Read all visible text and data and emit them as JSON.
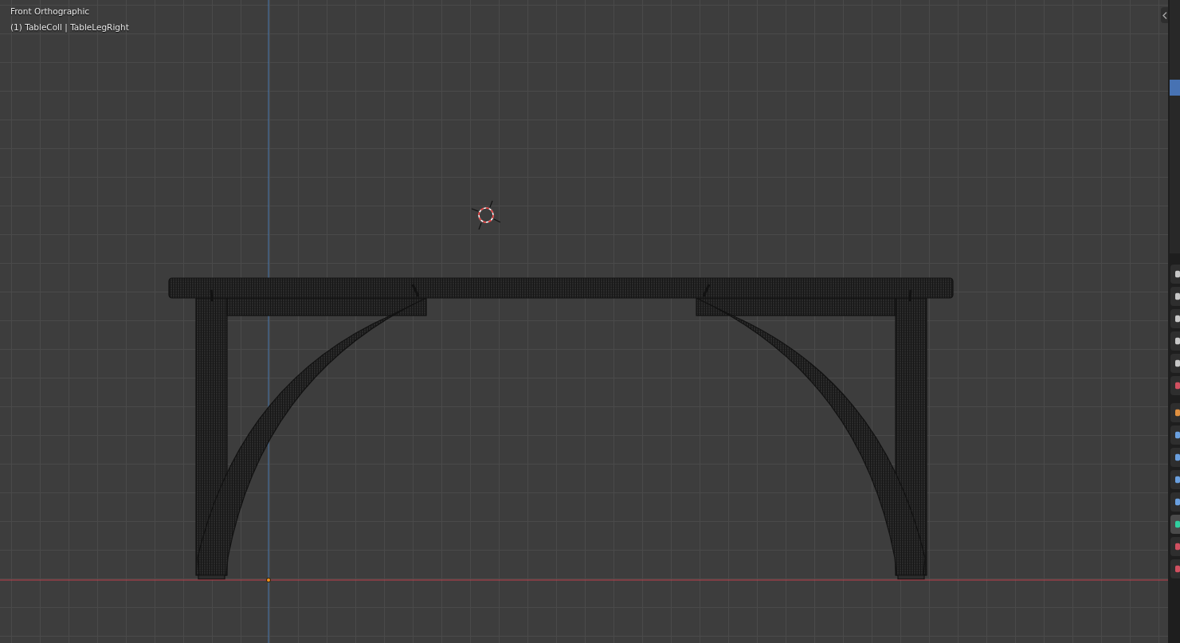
{
  "viewport": {
    "view_name": "Front Orthographic",
    "object_info": "(1) TableColl | TableLegRight"
  },
  "property_tabs": [
    {
      "kind": "tool",
      "selected": false
    },
    {
      "kind": "render",
      "selected": false
    },
    {
      "kind": "output",
      "selected": false
    },
    {
      "kind": "view-layer",
      "selected": false
    },
    {
      "kind": "scene",
      "selected": false
    },
    {
      "kind": "world",
      "selected": false
    },
    {
      "kind": "object",
      "selected": false
    },
    {
      "kind": "modifier",
      "selected": false
    },
    {
      "kind": "particles",
      "selected": false
    },
    {
      "kind": "physics",
      "selected": false
    },
    {
      "kind": "constraint",
      "selected": false
    },
    {
      "kind": "data",
      "selected": true
    },
    {
      "kind": "material",
      "selected": false
    },
    {
      "kind": "texture",
      "selected": false
    }
  ]
}
